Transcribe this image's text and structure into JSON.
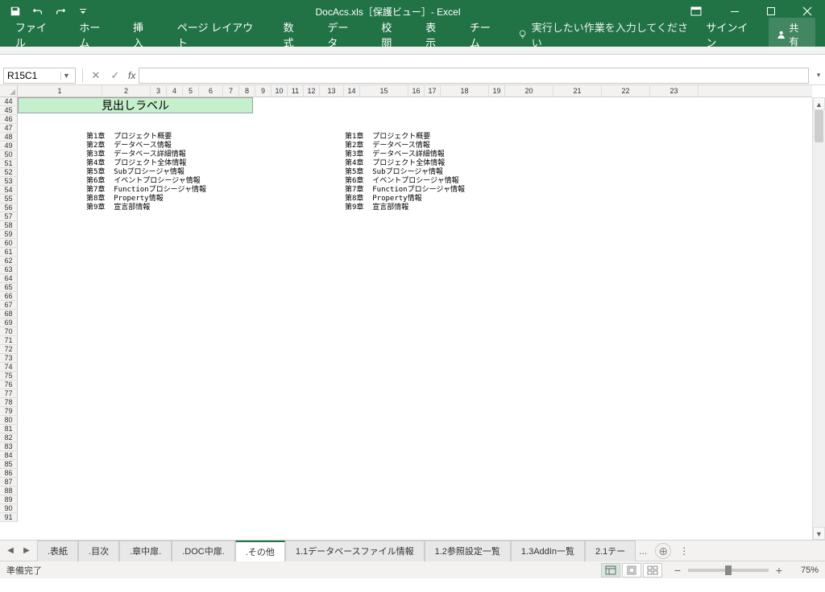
{
  "titlebar": {
    "title": "DocAcs.xls［保護ビュー］- Excel"
  },
  "ribbon": {
    "tabs": [
      "ファイル",
      "ホーム",
      "挿入",
      "ページ レイアウト",
      "数式",
      "データ",
      "校閲",
      "表示",
      "チーム"
    ],
    "tell_me": "実行したい作業を入力してください",
    "sign_in": "サインイン",
    "share": "共有"
  },
  "formula_bar": {
    "name_box": "R15C1",
    "fx": "fx",
    "formula": ""
  },
  "grid": {
    "first_row": 44,
    "col_labels": [
      "1",
      "2",
      "3",
      "4",
      "5",
      "6",
      "7",
      "8",
      "9",
      "10",
      "11",
      "12",
      "13",
      "14",
      "15",
      "16",
      "17",
      "18",
      "19",
      "20",
      "21",
      "22",
      "23"
    ],
    "heading_cell": "見出しラベル",
    "left_block": "第1章  プロジェクト概要\n第2章  データベース情報\n第3章  データベース詳細情報\n第4章  プロジェクト全体情報\n第5章  Subプロシージャ情報\n第6章  イベントプロシージャ情報\n第7章  Functionプロシージャ情報\n第8章  Property情報\n第9章  宣言部情報",
    "right_block": "第1章  プロジェクト概要\n第2章  データベース情報\n第3章  データベース詳細情報\n第4章  プロジェクト全体情報\n第5章  Subプロシージャ情報\n第6章  イベントプロシージャ情報\n第7章  Functionプロシージャ情報\n第8章  Property情報\n第9章  宣言部情報"
  },
  "sheet_tabs": {
    "tabs": [
      ".表紙",
      ".目次",
      ".章中扉.",
      ".DOC中扉.",
      ".その他",
      "1.1データベースファイル情報",
      "1.2参照設定一覧",
      "1.3AddIn一覧",
      "2.1テー"
    ],
    "active_index": 4,
    "overflow": "..."
  },
  "status_bar": {
    "ready": "準備完了",
    "zoom": "75%"
  }
}
